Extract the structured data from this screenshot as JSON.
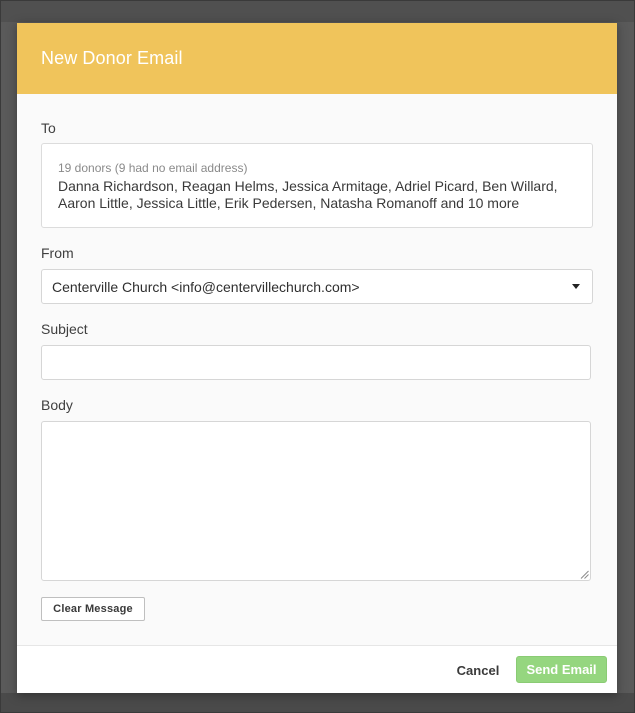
{
  "modal": {
    "title": "New Donor Email"
  },
  "to": {
    "label": "To",
    "count_text": "19 donors (9 had no email address)",
    "recipients_text": "Danna Richardson, Reagan Helms, Jessica Armitage, Adriel Picard, Ben Willard, Aaron Little, Jessica Little, Erik Pedersen, Natasha Romanoff and 10 more"
  },
  "from": {
    "label": "From",
    "selected_value": "Centerville Church <info@centervillechurch.com>"
  },
  "subject": {
    "label": "Subject",
    "value": "",
    "placeholder": ""
  },
  "body": {
    "label": "Body",
    "value": ""
  },
  "actions": {
    "clear_label": "Clear Message",
    "cancel_label": "Cancel",
    "send_label": "Send Email"
  },
  "colors": {
    "header": "#f0c45b",
    "send_button": "#95d67f"
  },
  "icons": {
    "from_dropdown": "caret-down-icon",
    "body_resize": "resize-grip-icon"
  }
}
